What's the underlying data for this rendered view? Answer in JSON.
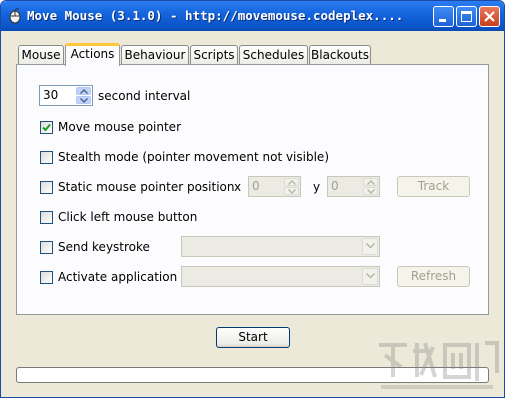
{
  "window": {
    "title": "Move Mouse (3.1.0) - http://movemouse.codeplex....",
    "controls": [
      "minimize-icon",
      "maximize-icon",
      "close-icon"
    ]
  },
  "tabs": [
    {
      "label": "Mouse",
      "active": false
    },
    {
      "label": "Actions",
      "active": true
    },
    {
      "label": "Behaviour",
      "active": false
    },
    {
      "label": "Scripts",
      "active": false
    },
    {
      "label": "Schedules",
      "active": false
    },
    {
      "label": "Blackouts",
      "active": false
    }
  ],
  "actions": {
    "interval_value": "30",
    "interval_label": "second interval",
    "move_pointer": {
      "label": "Move mouse pointer",
      "checked": true
    },
    "stealth_mode": {
      "label": "Stealth mode (pointer movement not visible)",
      "checked": false
    },
    "static_position": {
      "label": "Static mouse pointer position",
      "checked": false
    },
    "x_label": "x",
    "x_value": "0",
    "y_label": "y",
    "y_value": "0",
    "track_button": "Track",
    "click_left": {
      "label": "Click left mouse button",
      "checked": false
    },
    "send_keystroke": {
      "label": "Send keystroke",
      "checked": false
    },
    "activate_app": {
      "label": "Activate application",
      "checked": false
    },
    "refresh_button": "Refresh"
  },
  "footer": {
    "start_button": "Start",
    "progress": 0
  },
  "colors": {
    "titlebar": "#0b54c9",
    "active_tab_accent": "#ffc83c",
    "button_border": "#003c74"
  }
}
